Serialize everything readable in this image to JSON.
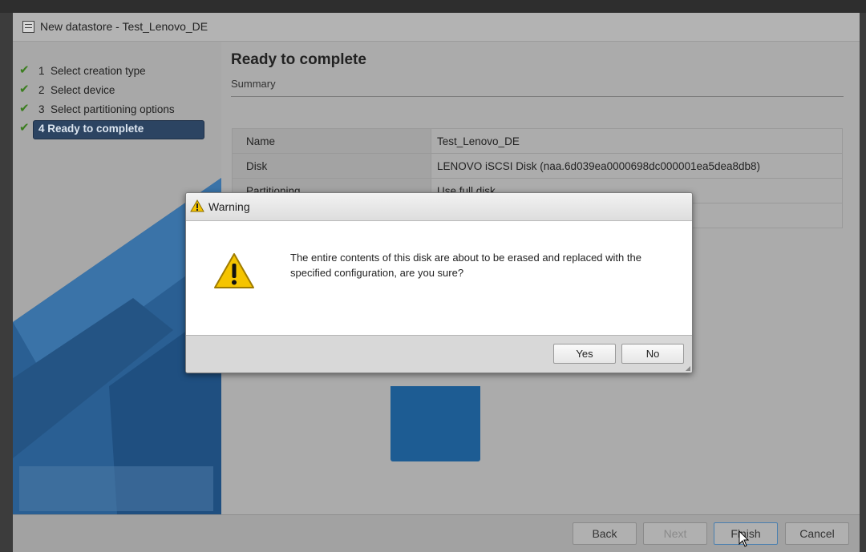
{
  "window": {
    "title": "New datastore - Test_Lenovo_DE",
    "window_icon": "datastore-icon"
  },
  "steps": [
    {
      "number": "1",
      "label": "Select creation type",
      "done": true
    },
    {
      "number": "2",
      "label": "Select device",
      "done": true
    },
    {
      "number": "3",
      "label": "Select partitioning options",
      "done": true
    },
    {
      "number": "4",
      "label": "Ready to complete",
      "done": true,
      "active": true
    }
  ],
  "main": {
    "heading": "Ready to complete",
    "subheading": "Summary",
    "rows": [
      {
        "key": "Name",
        "value": "Test_Lenovo_DE"
      },
      {
        "key": "Disk",
        "value": "LENOVO iSCSI Disk (naa.6d039ea0000698dc000001ea5dea8db8)"
      },
      {
        "key": "Partitioning",
        "value": "Use full disk"
      },
      {
        "key": "",
        "value": ""
      }
    ]
  },
  "footer": {
    "back": "Back",
    "next": "Next",
    "finish": "Finish",
    "cancel": "Cancel"
  },
  "dialog": {
    "title": "Warning",
    "message": "The entire contents of this disk are about to be erased and replaced with the specified configuration, are you sure?",
    "yes": "Yes",
    "no": "No",
    "icon": "warning-icon"
  },
  "colors": {
    "accent": "#2c4462",
    "check": "#3a7d1e",
    "warning": "#f5c400",
    "brand_blue": "#1d5c93"
  }
}
